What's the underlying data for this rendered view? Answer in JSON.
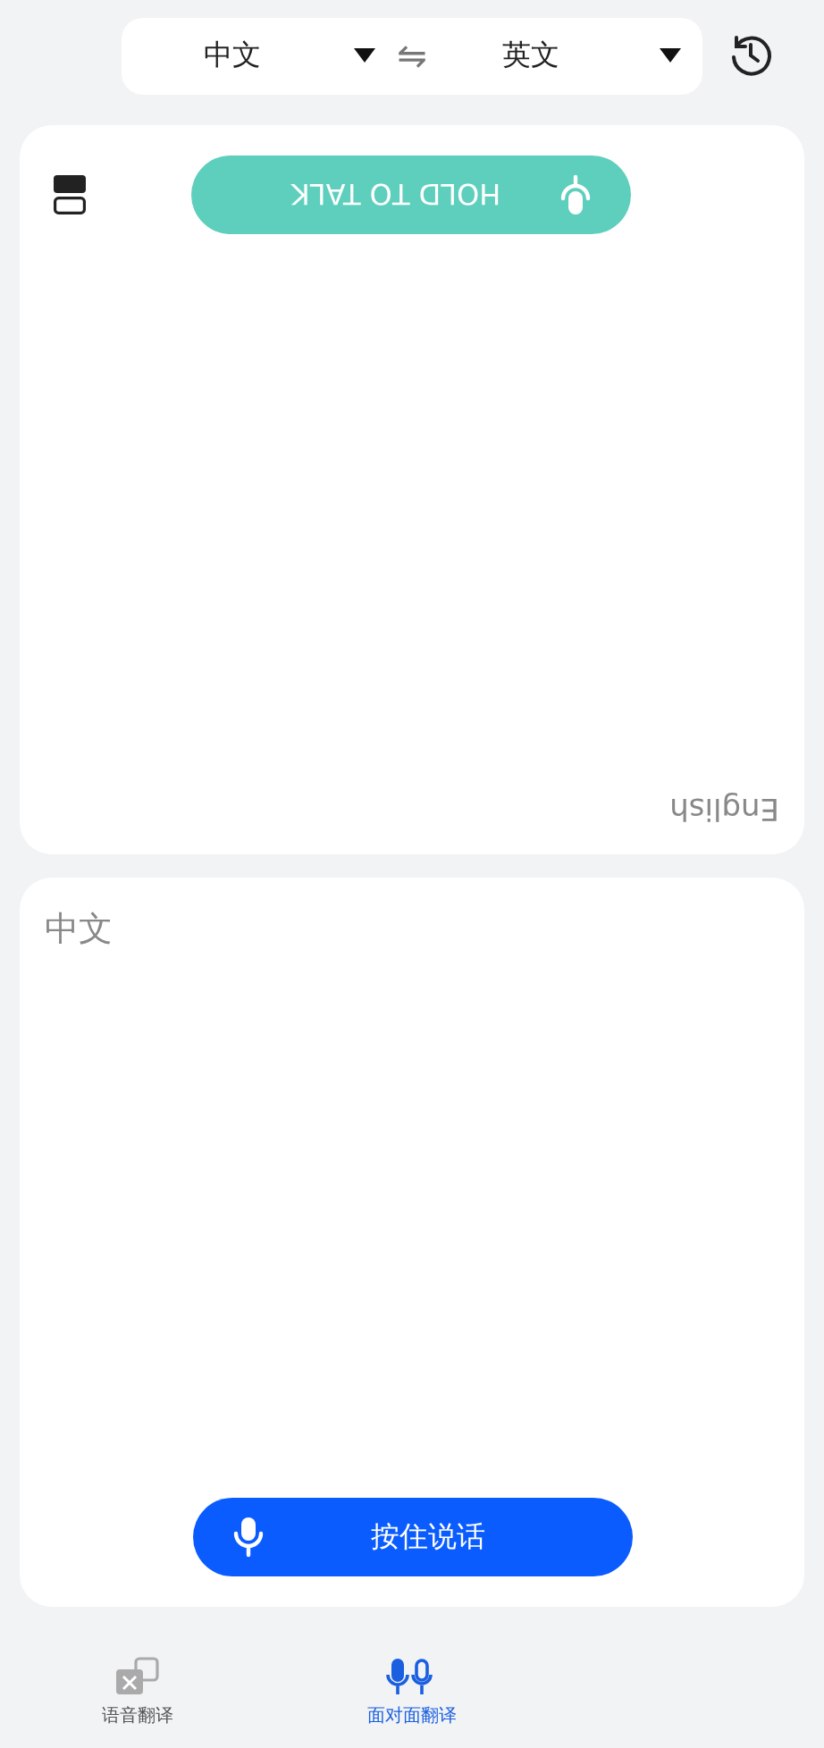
{
  "language_bar": {
    "source": "中文",
    "target": "英文",
    "swap_icon": "⇋"
  },
  "panels": [
    {
      "kind": "flipped",
      "language": "English",
      "button": "HOLD TO TALK",
      "color": "#5ecfbd"
    },
    {
      "kind": "upright",
      "language": "中文",
      "button": "按住说话",
      "color": "#0b5cff"
    }
  ],
  "nav": [
    {
      "label": "语音翻译",
      "kind": "text",
      "selected": false
    },
    {
      "label": "面对面翻译",
      "kind": "mics",
      "selected": true
    }
  ]
}
